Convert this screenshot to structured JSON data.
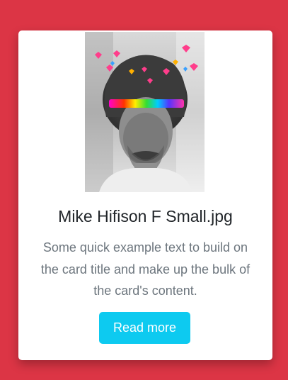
{
  "colors": {
    "page_background": "#dc3545",
    "card_background": "#ffffff",
    "button_background": "#0dcaf0",
    "button_text": "#ffffff",
    "title_text": "#212529",
    "body_text": "#6c757d"
  },
  "card": {
    "image_icon": "portrait-photo-icon",
    "title": "Mike Hifison F Small.jpg",
    "text": "Some quick example text to build on the card title and make up the bulk of the card's content.",
    "button_label": "Read more"
  }
}
